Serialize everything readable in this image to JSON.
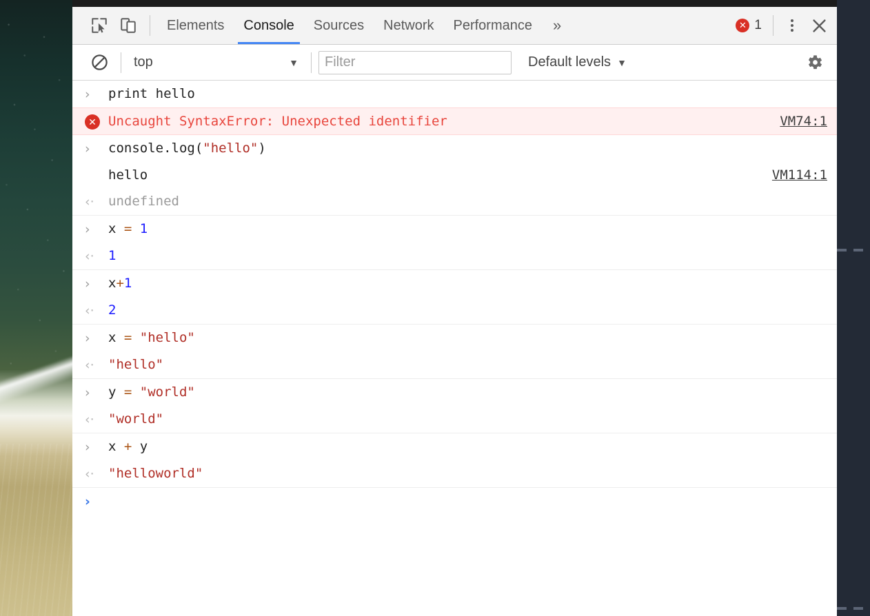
{
  "window": {
    "app": "Chrome DevTools",
    "panel": "Console"
  },
  "tabbar": {
    "inspect_icon": "inspect-cursor-icon",
    "device_icon": "device-toggle-icon",
    "tabs": [
      {
        "label": "Elements",
        "selected": false
      },
      {
        "label": "Console",
        "selected": true
      },
      {
        "label": "Sources",
        "selected": false
      },
      {
        "label": "Network",
        "selected": false
      },
      {
        "label": "Performance",
        "selected": false
      }
    ],
    "more_tabs_label": "»",
    "error_badge": {
      "icon": "error-circle-icon",
      "count": "1"
    },
    "kebab_icon": "more-options-icon",
    "close_icon": "close-icon"
  },
  "filterbar": {
    "clear_icon": "clear-console-icon",
    "context": {
      "value": "top",
      "caret": "▼"
    },
    "filter": {
      "value": "",
      "placeholder": "Filter"
    },
    "levels": {
      "value": "Default levels",
      "caret": "▼"
    },
    "settings_icon": "gear-icon"
  },
  "console": {
    "prompt_in": "›",
    "prompt_out": "‹·",
    "messages": [
      {
        "kind": "input",
        "tokens": [
          {
            "t": "print hello",
            "c": "plain"
          }
        ],
        "source": "",
        "group_end": false
      },
      {
        "kind": "error",
        "text": "Uncaught SyntaxError: Unexpected identifier",
        "source": "VM74:1",
        "group_end": false
      },
      {
        "kind": "input",
        "tokens": [
          {
            "t": "console.log(",
            "c": "plain"
          },
          {
            "t": "\"hello\"",
            "c": "str"
          },
          {
            "t": ")",
            "c": "plain"
          }
        ],
        "source": "",
        "group_end": false
      },
      {
        "kind": "log",
        "tokens": [
          {
            "t": "hello",
            "c": "plain"
          }
        ],
        "source": "VM114:1",
        "group_end": false
      },
      {
        "kind": "result",
        "tokens": [
          {
            "t": "undefined",
            "c": "undef"
          }
        ],
        "source": "",
        "group_end": true
      },
      {
        "kind": "input",
        "tokens": [
          {
            "t": "x ",
            "c": "plain"
          },
          {
            "t": "=",
            "c": "op"
          },
          {
            "t": " ",
            "c": "plain"
          },
          {
            "t": "1",
            "c": "num"
          }
        ],
        "source": "",
        "group_end": false
      },
      {
        "kind": "result",
        "tokens": [
          {
            "t": "1",
            "c": "num"
          }
        ],
        "source": "",
        "group_end": true
      },
      {
        "kind": "input",
        "tokens": [
          {
            "t": "x",
            "c": "plain"
          },
          {
            "t": "+",
            "c": "op"
          },
          {
            "t": "1",
            "c": "num"
          }
        ],
        "source": "",
        "group_end": false
      },
      {
        "kind": "result",
        "tokens": [
          {
            "t": "2",
            "c": "num"
          }
        ],
        "source": "",
        "group_end": true
      },
      {
        "kind": "input",
        "tokens": [
          {
            "t": "x ",
            "c": "plain"
          },
          {
            "t": "=",
            "c": "op"
          },
          {
            "t": " ",
            "c": "plain"
          },
          {
            "t": "\"hello\"",
            "c": "str"
          }
        ],
        "source": "",
        "group_end": false
      },
      {
        "kind": "result",
        "tokens": [
          {
            "t": "\"hello\"",
            "c": "str"
          }
        ],
        "source": "",
        "group_end": true
      },
      {
        "kind": "input",
        "tokens": [
          {
            "t": "y ",
            "c": "plain"
          },
          {
            "t": "=",
            "c": "op"
          },
          {
            "t": " ",
            "c": "plain"
          },
          {
            "t": "\"world\"",
            "c": "str"
          }
        ],
        "source": "",
        "group_end": false
      },
      {
        "kind": "result",
        "tokens": [
          {
            "t": "\"world\"",
            "c": "str"
          }
        ],
        "source": "",
        "group_end": true
      },
      {
        "kind": "input",
        "tokens": [
          {
            "t": "x ",
            "c": "plain"
          },
          {
            "t": "+",
            "c": "op"
          },
          {
            "t": " y",
            "c": "plain"
          }
        ],
        "source": "",
        "group_end": false
      },
      {
        "kind": "result",
        "tokens": [
          {
            "t": "\"helloworld\"",
            "c": "str"
          }
        ],
        "source": "",
        "group_end": true
      }
    ],
    "active_prompt": "›"
  },
  "colors": {
    "accent": "#4285f4",
    "error": "#d93025",
    "error_text": "#e8453c",
    "error_bg": "#fff0f0",
    "string": "#b02e26",
    "number": "#1a1aff",
    "operator": "#ab5516",
    "undefined": "#9a9a9a",
    "toolbar_bg": "#f3f3f3",
    "desktop_void": "#232a36"
  }
}
